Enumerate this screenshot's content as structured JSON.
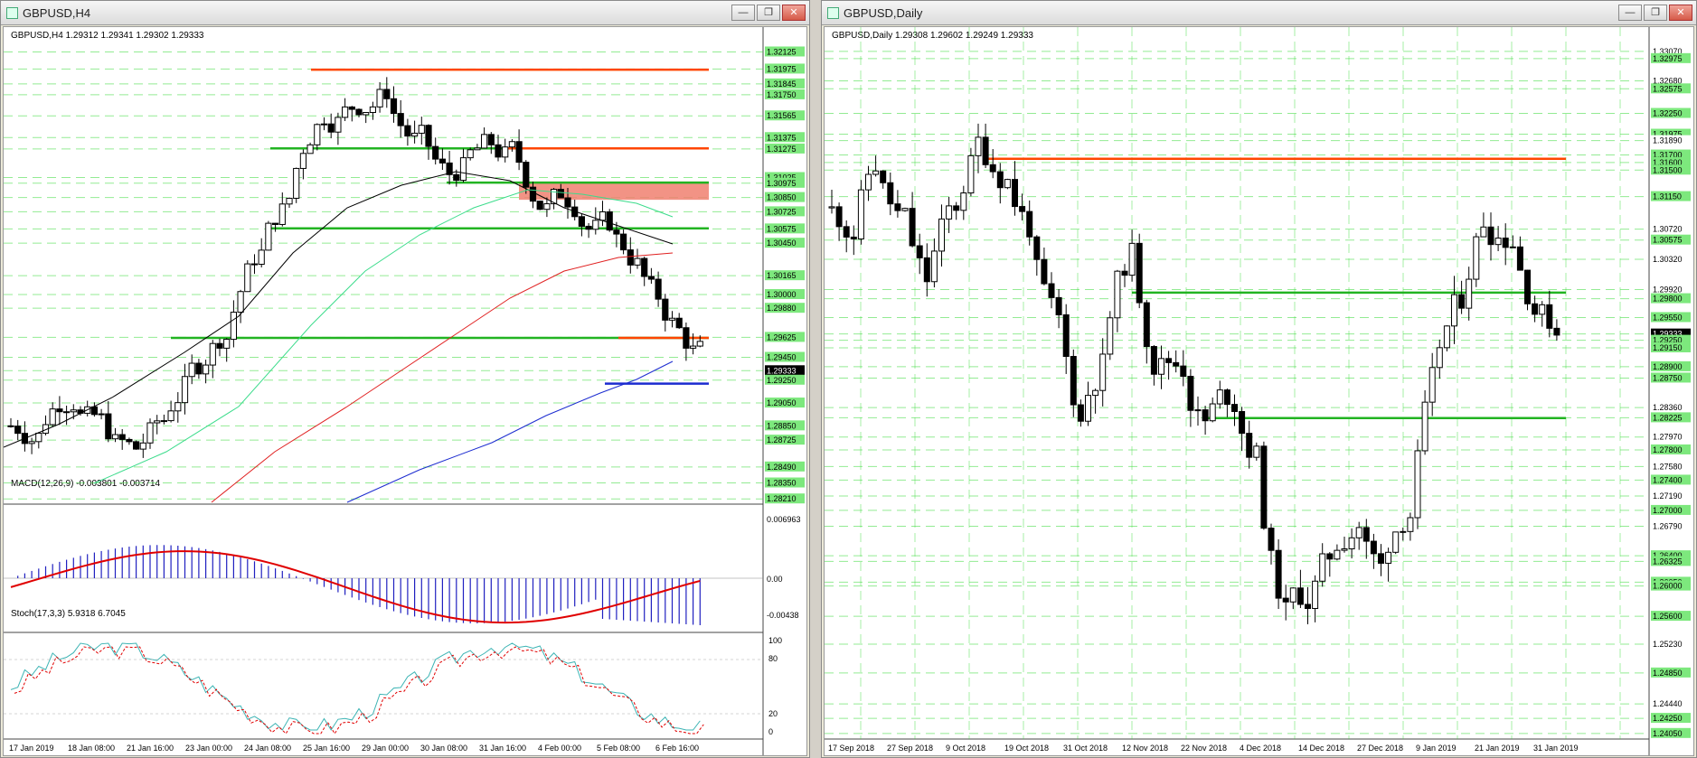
{
  "left_window": {
    "title": "GBPUSD,H4",
    "buttons": [
      "—",
      "❐",
      "✕"
    ],
    "price_header": "GBPUSD,H4  1.29312 1.29341 1.29302 1.29333",
    "price_labels": [
      "1.32125",
      "1.31975",
      "1.31845",
      "1.31750",
      "1.31565",
      "1.31375",
      "1.31275",
      "1.31025",
      "1.30975",
      "1.30850",
      "1.30725",
      "1.30575",
      "1.30450",
      "1.30165",
      "1.30000",
      "1.29880",
      "1.29625",
      "1.29450",
      "1.29333",
      "1.29250",
      "1.29050",
      "1.28850",
      "1.28725",
      "1.28490",
      "1.28350",
      "1.28210"
    ],
    "current_price": "1.29333",
    "macd_header": "MACD(12,26,9) -0.003801 -0.003714",
    "macd_labels": [
      "0.006963",
      "0.00",
      "-0.00438"
    ],
    "stoch_header": "Stoch(17,3,3) 5.9318 6.7045",
    "stoch_labels": [
      "100",
      "80",
      "20",
      "0"
    ],
    "time_labels": [
      "17 Jan 2019",
      "18 Jan 08:00",
      "21 Jan 16:00",
      "23 Jan 00:00",
      "24 Jan 08:00",
      "25 Jan 16:00",
      "29 Jan 00:00",
      "30 Jan 08:00",
      "31 Jan 16:00",
      "4 Feb 00:00",
      "5 Feb 08:00",
      "6 Feb 16:00"
    ]
  },
  "right_window": {
    "title": "GBPUSD,Daily",
    "buttons": [
      "—",
      "❐",
      "✕"
    ],
    "price_header": "GBPUSD,Daily  1.29308 1.29602 1.29249 1.29333",
    "price_labels": [
      "1.33070",
      "1.32975",
      "1.32680",
      "1.32575",
      "1.32250",
      "1.31975",
      "1.31890",
      "1.31700",
      "1.31600",
      "1.31500",
      "1.31150",
      "1.30720",
      "1.30575",
      "1.30320",
      "1.29920",
      "1.29800",
      "1.29550",
      "1.29333",
      "1.29250",
      "1.29150",
      "1.28900",
      "1.28750",
      "1.28360",
      "1.28225",
      "1.27970",
      "1.27800",
      "1.27580",
      "1.27400",
      "1.27190",
      "1.27000",
      "1.26790",
      "1.26400",
      "1.26325",
      "1.26050",
      "1.26000",
      "1.25600",
      "1.25230",
      "1.24850",
      "1.24440",
      "1.24250",
      "1.24050"
    ],
    "current_price": "1.29333",
    "time_labels": [
      "17 Sep 2018",
      "27 Sep 2018",
      "9 Oct 2018",
      "19 Oct 2018",
      "31 Oct 2018",
      "12 Nov 2018",
      "22 Nov 2018",
      "4 Dec 2018",
      "14 Dec 2018",
      "27 Dec 2018",
      "9 Jan 2019",
      "21 Jan 2019",
      "31 Jan 2019"
    ]
  },
  "colors": {
    "support_resistance_green": "#22b422",
    "resistance_red": "#ff4500",
    "zone_red": "#f08070",
    "ma_black": "#000000",
    "ma_green": "#3cdc8c",
    "ma_red": "#e02020",
    "ma_blue": "#1c2cd0",
    "macd_hist": "#2020c0",
    "macd_signal": "#e00000",
    "stoch_main": "#3cb4b4",
    "stoch_signal": "#e00000",
    "label_bg": "#7de87d"
  }
}
